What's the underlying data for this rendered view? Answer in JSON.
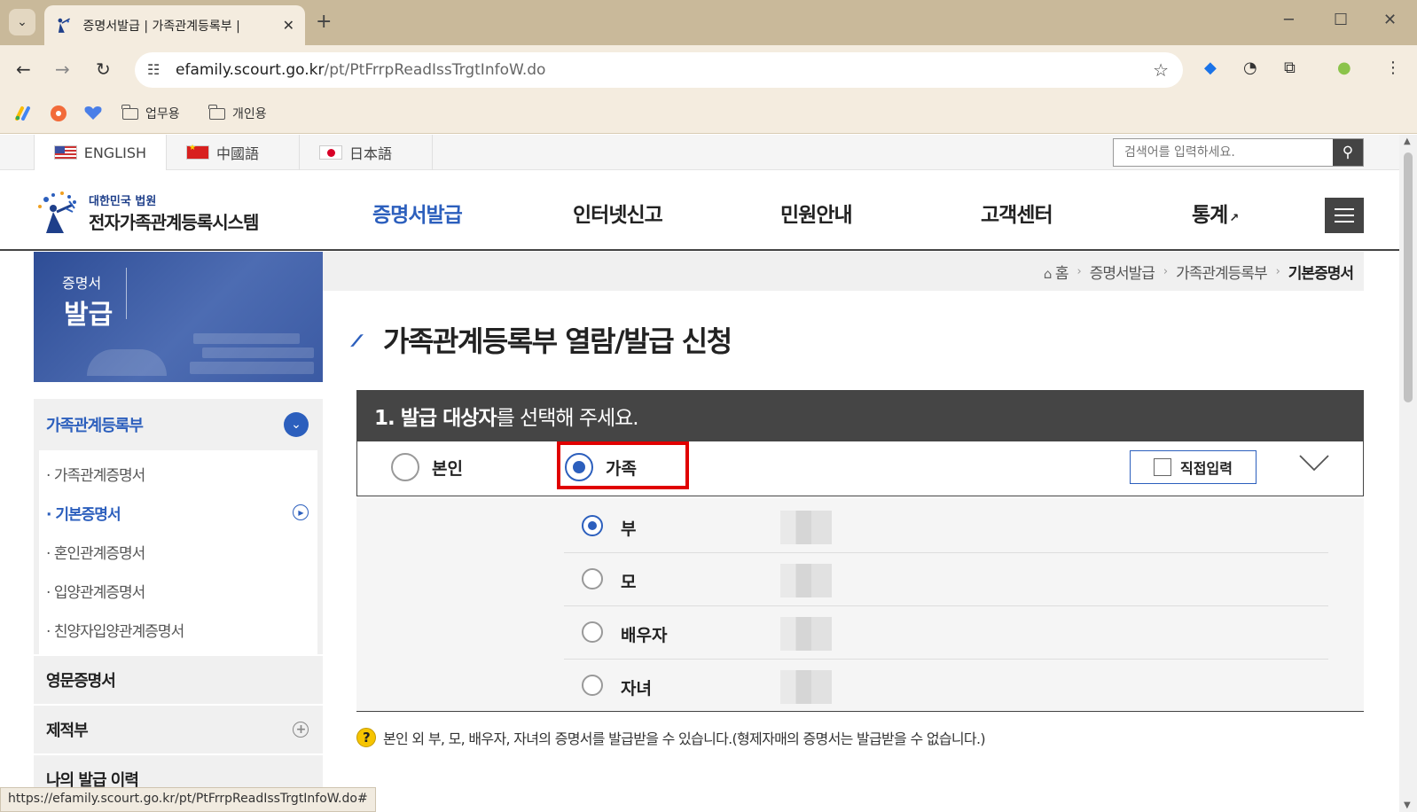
{
  "browser": {
    "tab_title": "증명서발급 | 가족관계등록부 |",
    "url_host": "efamily.scourt.go.kr",
    "url_path": "/pt/PtFrrpReadIssTrgtInfoW.do",
    "bookmarks": [
      "업무용",
      "개인용"
    ],
    "status_url": "https://efamily.scourt.go.kr/pt/PtFrrpReadIssTrgtInfoW.do#"
  },
  "langbar": {
    "languages": [
      "ENGLISH",
      "中國語",
      "日本語"
    ],
    "search_placeholder": "검색어를 입력하세요."
  },
  "header": {
    "logo_sub": "대한민국 법원",
    "logo_main": "전자가족관계등록시스템",
    "nav": [
      "증명서발급",
      "인터넷신고",
      "민원안내",
      "고객센터",
      "통계"
    ]
  },
  "banner": {
    "line1": "증명서",
    "line2": "발급"
  },
  "sidebar": {
    "group_title": "가족관계등록부",
    "items": [
      "가족관계증명서",
      "기본증명서",
      "혼인관계증명서",
      "입양관계증명서",
      "친양자입양관계증명서"
    ],
    "blocks": [
      "영문증명서",
      "제적부",
      "나의 발급 이력"
    ]
  },
  "breadcrumb": [
    "홈",
    "증명서발급",
    "가족관계등록부",
    "기본증명서"
  ],
  "page_title": "가족관계등록부 열람/발급 신청",
  "section": {
    "head_bold": "1. 발급 대상자",
    "head_rest": "를 선택해 주세요.",
    "options": [
      "본인",
      "가족"
    ],
    "selected_option": "가족",
    "direct_input": "직접입력"
  },
  "family": {
    "members": [
      "부",
      "모",
      "배우자",
      "자녀"
    ],
    "selected_member": "부"
  },
  "note": "본인 외 부, 모, 배우자, 자녀의 증명서를 발급받을 수 있습니다.(형제자매의 증명서는 발급받을 수 없습니다.)",
  "colors": {
    "brand_blue": "#2c5fbd",
    "section_dark": "#454545",
    "highlight_red": "#e00000"
  }
}
